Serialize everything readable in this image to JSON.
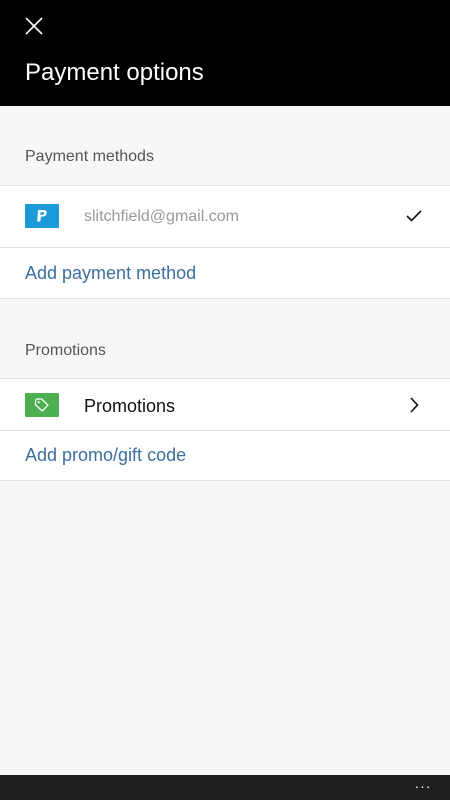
{
  "header": {
    "title": "Payment options",
    "close_icon": "close-icon",
    "background": "#000000"
  },
  "payment_methods": {
    "section_title": "Payment methods",
    "items": [
      {
        "icon": "paypal-icon",
        "badge_color": "#1a9ad9",
        "label": "slitchfield@gmail.com",
        "selected": true,
        "check_icon": "checkmark-icon"
      }
    ],
    "add_label": "Add payment method"
  },
  "promotions": {
    "section_title": "Promotions",
    "item": {
      "icon": "tag-icon",
      "badge_color": "#4caf50",
      "label": "Promotions",
      "chevron_icon": "chevron-right-icon"
    },
    "add_label": "Add promo/gift code"
  },
  "app_bar": {
    "more_label": "···",
    "more_icon": "more-icon"
  },
  "colors": {
    "link": "#3a6f9f",
    "page_bg": "#f7f7f7",
    "muted_text": "#999999"
  }
}
